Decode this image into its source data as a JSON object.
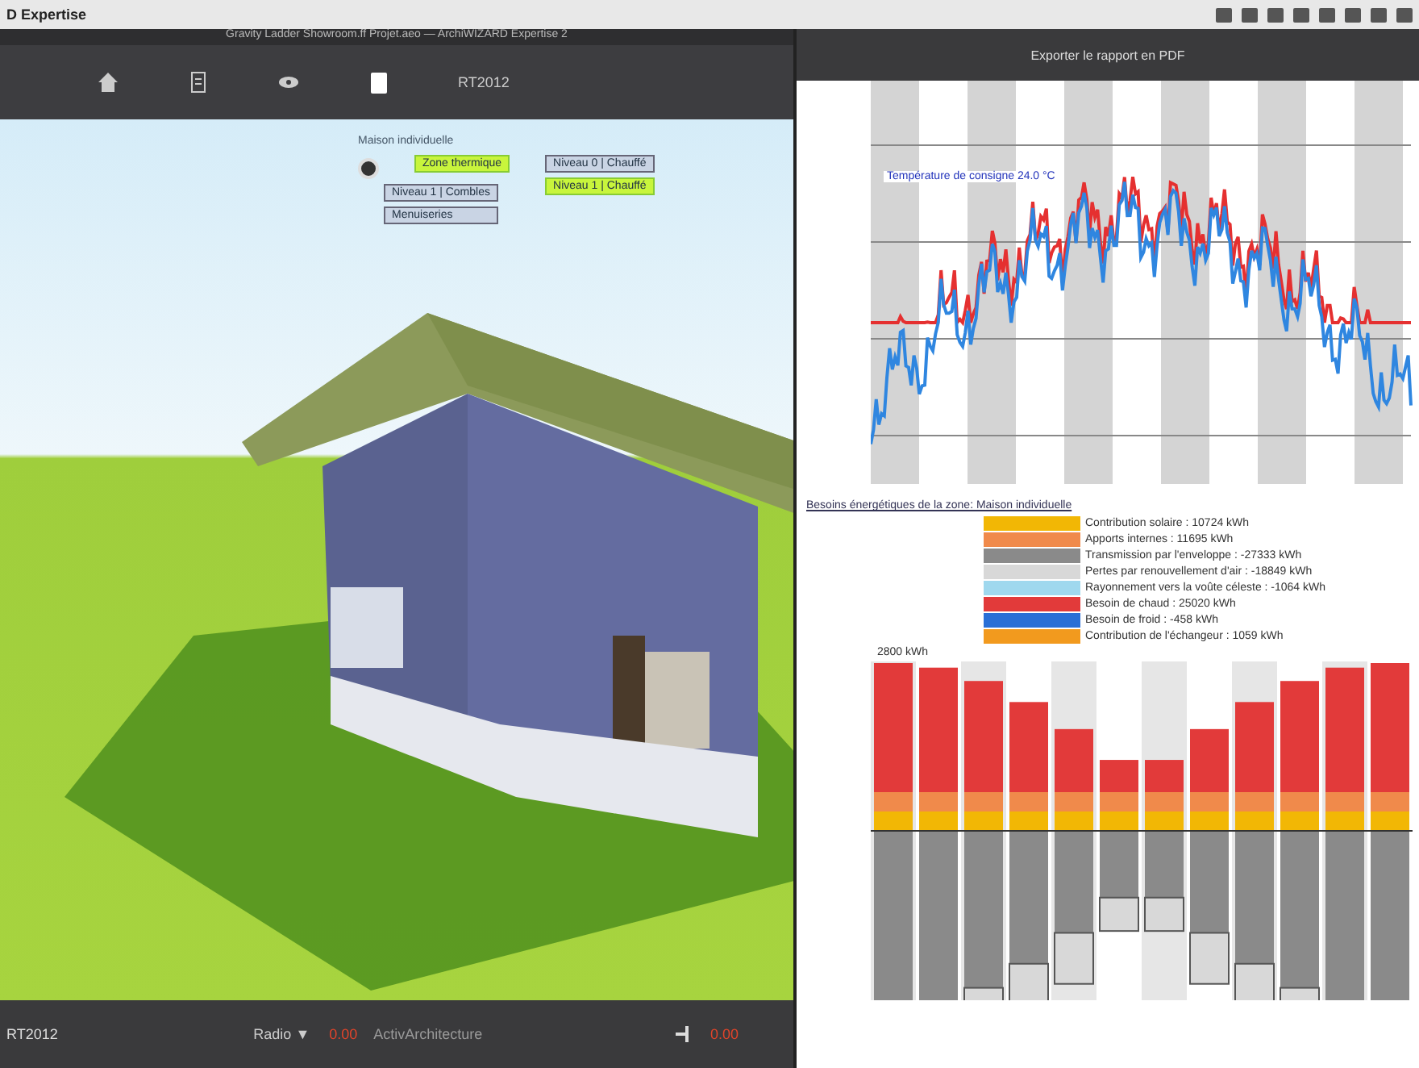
{
  "menubar": {
    "app_name": "D Expertise"
  },
  "window": {
    "title": "Gravity Ladder Showroom.ff Projet.aeo — ArchiWIZARD Expertise 2"
  },
  "toolbar": {
    "items": [
      {
        "kind": "home",
        "selected": false
      },
      {
        "kind": "list",
        "selected": false
      },
      {
        "kind": "eye",
        "selected": false
      },
      {
        "kind": "clipboard",
        "selected": true
      },
      {
        "kind": "text",
        "label": "RT2012",
        "selected": false
      }
    ]
  },
  "tree": {
    "root": "Maison individuelle",
    "children": [
      {
        "label": "Zone thermique",
        "selected": true,
        "children": [
          {
            "label": "Niveau 0 | Chauffé",
            "selected": false
          },
          {
            "label": "Niveau 1 | Chauffé",
            "selected": true
          }
        ]
      },
      {
        "label": "Niveau 1 | Combles",
        "selected": false
      },
      {
        "label": "Menuiseries",
        "selected": false
      }
    ]
  },
  "status_bar": {
    "left": "RT2012",
    "radio": "Radio ▼",
    "radio_value": "0.00",
    "project": "ActivArchitecture",
    "right_value": "0.00"
  },
  "report": {
    "header": "Exporter le rapport en PDF",
    "temperature_label": "Température de consigne 24.0 °C",
    "section_title": "Besoins énergétiques de la zone: Maison individuelle",
    "legend": [
      {
        "label": "Contribution solaire : 10724 kWh",
        "color": "#f2b705"
      },
      {
        "label": "Apports internes : 11695 kWh",
        "color": "#f08a4b"
      },
      {
        "label": "Transmission par l'enveloppe : -27333 kWh",
        "color": "#8a8a8a"
      },
      {
        "label": "Pertes par renouvellement d'air : -18849 kWh",
        "color": "#d8d8d8"
      },
      {
        "label": "Rayonnement vers la voûte céleste : -1064 kWh",
        "color": "#9fd8ee"
      },
      {
        "label": "Besoin de chaud : 25020 kWh",
        "color": "#e23a3a"
      },
      {
        "label": "Besoin de froid : -458 kWh",
        "color": "#2a6fd6"
      },
      {
        "label": "Contribution de l'échangeur : 1059 kWh",
        "color": "#f29a1e"
      }
    ],
    "bar_unit": "2800 kWh"
  }
}
